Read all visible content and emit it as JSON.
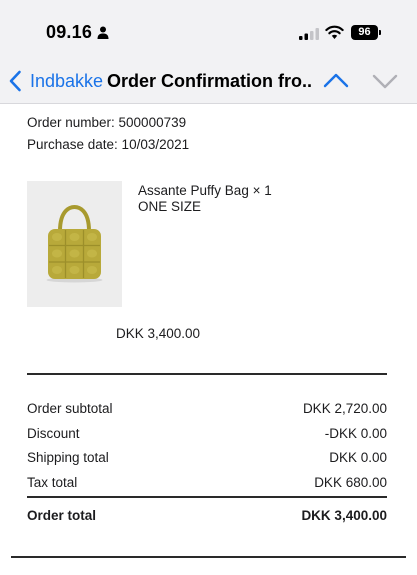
{
  "status_bar": {
    "time": "09.16",
    "battery": "96",
    "icons": [
      "person-icon",
      "signal-icon",
      "wifi-icon",
      "battery-icon"
    ]
  },
  "nav": {
    "back_label": "Indbakke",
    "title": "Order Confirmation fro...",
    "icons": [
      "chevron-left-icon",
      "chevron-up-icon",
      "chevron-down-icon"
    ],
    "accent_color": "#1a73e8"
  },
  "order": {
    "number": "Order number: 500000739",
    "purchase_date": "Purchase date: 10/03/2021"
  },
  "product": {
    "name": "Assante Puffy Bag × 1",
    "size": "ONE SIZE",
    "price": "DKK 3,400.00",
    "image_color": "#b8a93a"
  },
  "summary": {
    "subtotal_label": "Order subtotal",
    "subtotal_value": "DKK 2,720.00",
    "discount_label": "Discount",
    "discount_value": "-DKK 0.00",
    "shipping_label": "Shipping total",
    "shipping_value": "DKK 0.00",
    "tax_label": "Tax total",
    "tax_value": "DKK 680.00",
    "total_label": "Order total",
    "total_value": "DKK 3,400.00"
  }
}
